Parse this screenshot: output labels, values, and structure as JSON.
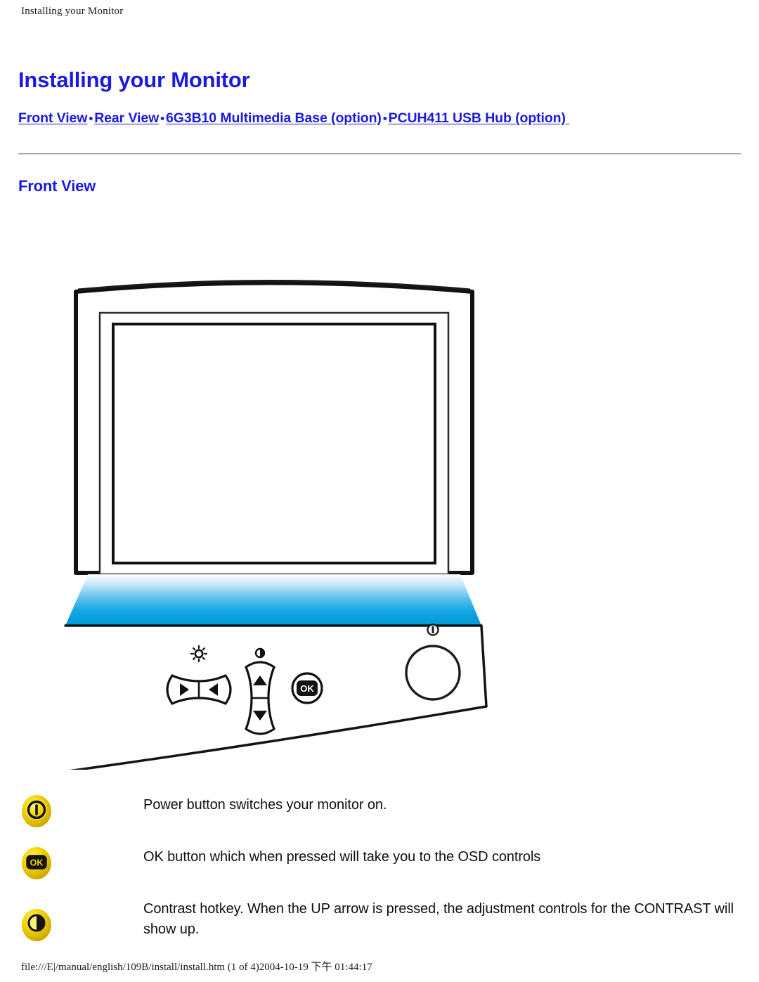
{
  "header": {
    "running_title": "Installing your Monitor"
  },
  "document": {
    "title": "Installing your Monitor",
    "section_title": "Front View",
    "nav": {
      "separator": "•",
      "links": [
        {
          "label": "Front View"
        },
        {
          "label": "Rear View"
        },
        {
          "label": "6G3B10 Multimedia Base (option)"
        },
        {
          "label": "PCUH411 USB Hub (option)"
        }
      ]
    }
  },
  "figure": {
    "alt": "Front view of monitor showing bezel, screen and control panel",
    "controls": [
      {
        "name": "brightness-control",
        "icon": "sun-icon",
        "arrows": [
          "left",
          "right"
        ]
      },
      {
        "name": "contrast-control",
        "icon": "contrast-icon",
        "arrows": [
          "up",
          "down"
        ]
      },
      {
        "name": "ok-button",
        "icon": "ok-icon",
        "label": "OK"
      },
      {
        "name": "power-button",
        "icon": "power-icon"
      }
    ]
  },
  "legend": {
    "items": [
      {
        "icon": "power-icon",
        "text": "Power button switches your monitor on."
      },
      {
        "icon": "ok-icon",
        "label": "OK",
        "text": "OK button which when pressed will take you to the OSD controls"
      },
      {
        "icon": "contrast-icon",
        "text": "Contrast hotkey. When the UP arrow is pressed, the adjustment controls for the CONTRAST will show up."
      }
    ]
  },
  "footer": {
    "path": "file:///E|/manual/english/109B/install/install.htm (1 of 4)2004-10-19 下午 01:44:17"
  },
  "colors": {
    "link": "#1b1bdd",
    "heading": "#1b1bdd",
    "panel_blue_top": "#ffffff",
    "panel_blue_bottom": "#009ad8",
    "icon_gold": "#f2d200",
    "icon_gold_dark": "#c9a400"
  }
}
